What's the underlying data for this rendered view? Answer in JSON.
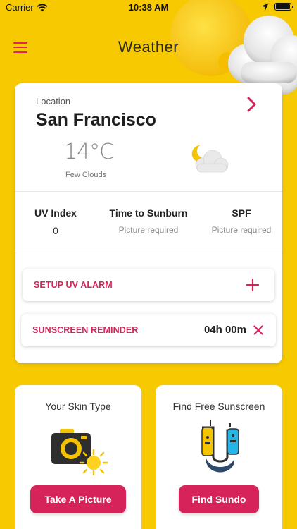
{
  "status_bar": {
    "carrier": "Carrier",
    "time": "10:38 AM"
  },
  "header": {
    "title": "Weather",
    "menu_icon": "hamburger-menu-icon"
  },
  "location": {
    "label": "Location",
    "name": "San Francisco",
    "temperature": "14°C",
    "condition": "Few Clouds",
    "weather_icon": "moon-cloud-icon"
  },
  "stats": [
    {
      "title": "UV Index",
      "value": "0"
    },
    {
      "title": "Time to Sunburn",
      "value": "Picture required"
    },
    {
      "title": "SPF",
      "value": "Picture required"
    }
  ],
  "actions": {
    "uv_alarm": {
      "label": "SETUP UV ALARM"
    },
    "sunscreen_reminder": {
      "label": "SUNSCREEN REMINDER",
      "timer": "04h 00m"
    }
  },
  "cards": {
    "skin_type": {
      "title": "Your Skin Type",
      "button": "Take A Picture"
    },
    "sunscreen": {
      "title": "Find Free Sunscreen",
      "button": "Find Sundo"
    }
  },
  "colors": {
    "background": "#F7C900",
    "accent": "#D6245B"
  }
}
